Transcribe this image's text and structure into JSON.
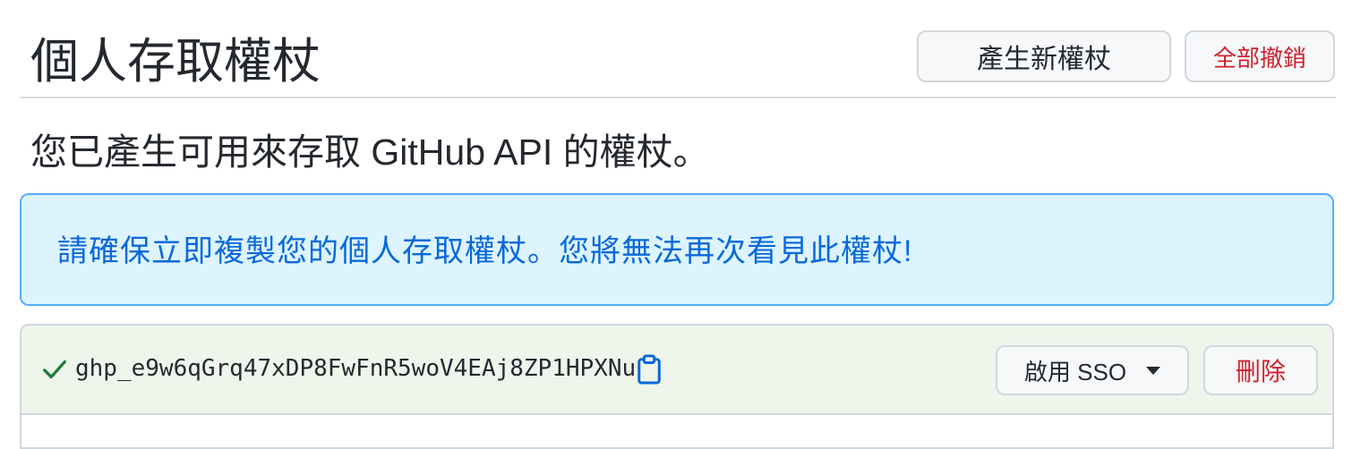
{
  "header": {
    "title": "個人存取權杖",
    "generate_button": "產生新權杖",
    "revoke_all_button": "全部撤銷"
  },
  "subtitle": "您已產生可用來存取 GitHub API 的權杖。",
  "flash": {
    "message": "請確保立即複製您的個人存取權杖。您將無法再次看見此權杖!"
  },
  "token": {
    "value": "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",
    "sso_button": "啟用 SSO",
    "delete_button": "刪除"
  },
  "icons": {
    "check": "check-icon",
    "copy": "clipboard-copy-icon",
    "caret": "caret-down-icon"
  },
  "colors": {
    "accent_blue": "#0969da",
    "danger_red": "#cf222e",
    "success_green": "#1a7f37",
    "flash_bg": "#ddf4ff",
    "token_row_bg": "#eef6ec"
  }
}
